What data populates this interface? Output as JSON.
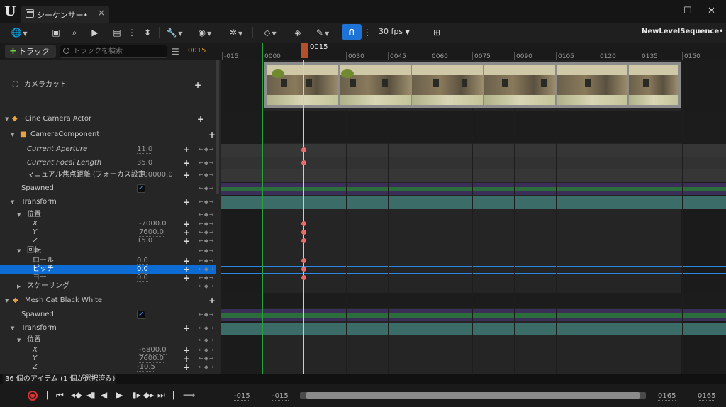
{
  "window": {
    "tab_title": "シーケンサー•",
    "logo": "U",
    "close_tab": "×",
    "minimize": "—",
    "maximize": "☐",
    "close": "✕"
  },
  "toolbar": {
    "fps": "30 fps",
    "sequence_name": "NewLevelSequence•",
    "snap_icon": "∩"
  },
  "track_header": {
    "add_track": "トラック",
    "search_placeholder": "トラックを検索",
    "current_frame": "0015"
  },
  "ruler": {
    "playhead_label": "0015",
    "ticks": [
      "-015",
      "0000",
      "0030",
      "0045",
      "0060",
      "0075",
      "0090",
      "0105",
      "0120",
      "0135",
      "0150"
    ]
  },
  "outliner": {
    "rows": [
      {
        "label": "カメラカット",
        "type": "track"
      },
      {
        "label": "Cine Camera Actor",
        "type": "actor"
      },
      {
        "label": "CameraComponent",
        "type": "component"
      },
      {
        "label": "Current Aperture",
        "value": "11.0",
        "italic": true
      },
      {
        "label": "Current Focal Length",
        "value": "35.0",
        "italic": true
      },
      {
        "label": "マニュアル焦点距離 (フォーカス設定",
        "value": "100000.0"
      },
      {
        "label": "Spawned",
        "checked": true
      },
      {
        "label": "Transform"
      },
      {
        "label": "位置"
      },
      {
        "label": "X",
        "value": "-7000.0",
        "italic": true
      },
      {
        "label": "Y",
        "value": "7600.0",
        "italic": true
      },
      {
        "label": "Z",
        "value": "15.0",
        "italic": true
      },
      {
        "label": "回転"
      },
      {
        "label": "ロール",
        "value": "0.0"
      },
      {
        "label": "ピッチ",
        "value": "0.0",
        "selected": true
      },
      {
        "label": "ヨー",
        "value": "0.0"
      },
      {
        "label": "スケーリング"
      },
      {
        "label": "Mesh Cat Black White",
        "type": "actor"
      },
      {
        "label": "Spawned",
        "checked": true
      },
      {
        "label": "Transform"
      },
      {
        "label": "位置"
      },
      {
        "label": "X",
        "value": "-6800.0",
        "italic": true
      },
      {
        "label": "Y",
        "value": "7600.0",
        "italic": true
      },
      {
        "label": "Z",
        "value": "-10.5",
        "italic": true
      }
    ]
  },
  "status": {
    "items": "36 個のアイテム (1 個が選択済み)"
  },
  "timebar": {
    "view_start": "-015",
    "work_start": "-015",
    "work_end": "0165",
    "view_end": "0165"
  },
  "colors": {
    "accent": "#0d6bd4",
    "playhead": "#b4502c",
    "keyframe": "#e86a6a",
    "range_start": "#2aa13a",
    "range_end": "#a82828"
  }
}
